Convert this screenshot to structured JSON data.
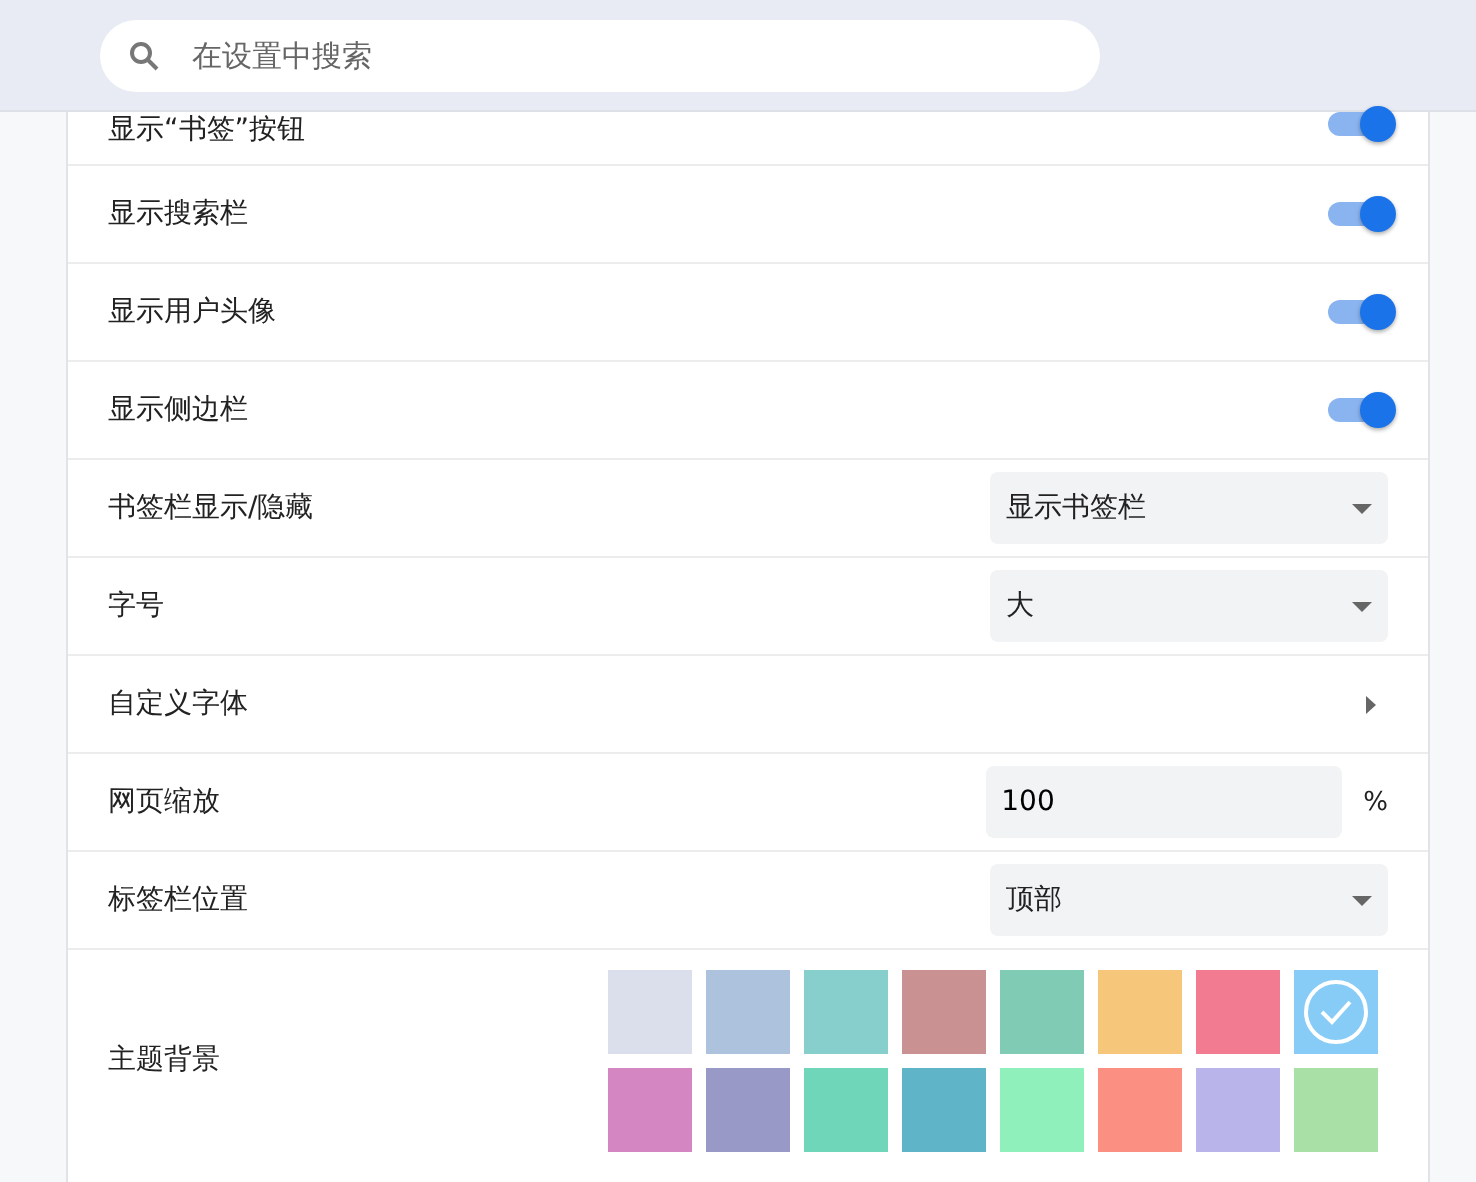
{
  "search": {
    "placeholder": "在设置中搜索"
  },
  "settings": [
    {
      "kind": "toggle",
      "label": "显示“书签”按钮",
      "on": true
    },
    {
      "kind": "toggle",
      "label": "显示搜索栏",
      "on": true
    },
    {
      "kind": "toggle",
      "label": "显示用户头像",
      "on": true
    },
    {
      "kind": "toggle",
      "label": "显示侧边栏",
      "on": true
    },
    {
      "kind": "select",
      "label": "书签栏显示/隐藏",
      "value": "显示书签栏"
    },
    {
      "kind": "select",
      "label": "字号",
      "value": "大"
    },
    {
      "kind": "link",
      "label": "自定义字体"
    },
    {
      "kind": "number",
      "label": "网页缩放",
      "value": "100",
      "unit": "%"
    },
    {
      "kind": "select",
      "label": "标签栏位置",
      "value": "顶部"
    },
    {
      "kind": "colors",
      "label": "主题背景",
      "swatches": [
        {
          "color": "#dadfeb",
          "selected": false
        },
        {
          "color": "#adc3dd",
          "selected": false
        },
        {
          "color": "#86cfcd",
          "selected": false
        },
        {
          "color": "#c99191",
          "selected": false
        },
        {
          "color": "#80cbb3",
          "selected": false
        },
        {
          "color": "#f6c77a",
          "selected": false
        },
        {
          "color": "#f27b92",
          "selected": false
        },
        {
          "color": "#87ccf6",
          "selected": true
        },
        {
          "color": "#d386c1",
          "selected": false
        },
        {
          "color": "#9999c7",
          "selected": false
        },
        {
          "color": "#70d6b9",
          "selected": false
        },
        {
          "color": "#5fb4c8",
          "selected": false
        },
        {
          "color": "#8ff0bb",
          "selected": false
        },
        {
          "color": "#fa8f82",
          "selected": false
        },
        {
          "color": "#b9b4ea",
          "selected": false
        },
        {
          "color": "#a8e0a6",
          "selected": false
        }
      ]
    }
  ]
}
